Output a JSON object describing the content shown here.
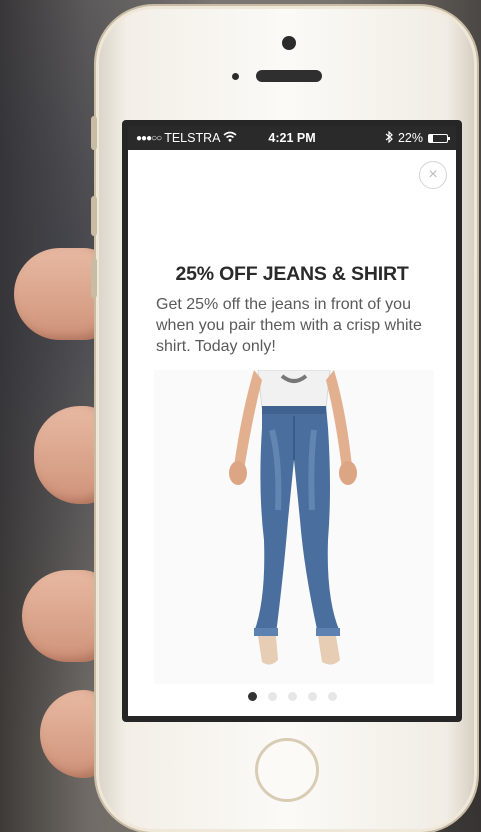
{
  "status_bar": {
    "signal": "●●●○○",
    "carrier": "TELSTRA",
    "wifi_icon": "wifi-icon",
    "time": "4:21 PM",
    "bluetooth_icon": "bluetooth-icon",
    "battery_percent": "22%",
    "battery_level": 0.22
  },
  "popup": {
    "close_icon": "close-icon",
    "close_glyph": "×",
    "headline": "25% OFF JEANS & SHIRT",
    "body": "Get 25% off the jeans in front of you when you pair them with a crisp white shirt. Today only!",
    "image": "product-image-jeans-shirt",
    "pagination": {
      "total": 5,
      "active": 1
    }
  },
  "colors": {
    "headline": "#2a2a2a",
    "body": "#5a5a5a",
    "status_bar_bg": "#2a2a2a",
    "jeans": "#4a6f9e"
  }
}
